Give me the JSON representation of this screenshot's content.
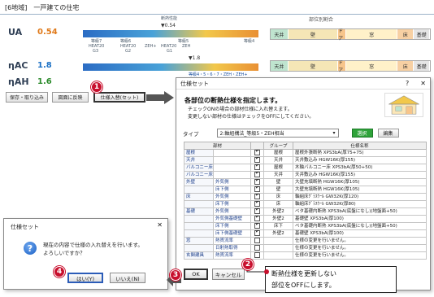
{
  "background": {
    "region_label": "[6地域]　一戸建ての住宅",
    "standard_caption": "断熱性能",
    "standard_value": "▼0.54",
    "parts_caption": "部位別割合",
    "metrics": [
      {
        "label": "UA",
        "value": "0.54",
        "color": "#e07a1a"
      },
      {
        "label": "ηAC",
        "value": "1.8",
        "color": "#1a6fc4"
      },
      {
        "label": "ηAH",
        "value": "1.6",
        "color": "#2a8a2a"
      }
    ],
    "ua_grades": [
      "等級7",
      "等級6",
      "等級5",
      "等級4"
    ],
    "ua_levels": [
      "HEAT20",
      "HEAT20",
      "ZEH+",
      "HEAT20",
      "ZEH"
    ],
    "ua_levels2": [
      "G3",
      "G2",
      "G1"
    ],
    "eta_mark": "▼1.8",
    "eta_grades": "等級4・5・6・7・ZEH・ZEH+",
    "parts_segments": [
      "天井",
      "壁",
      "ドア",
      "窓",
      "床",
      "基礎"
    ],
    "parts_colors": [
      "#bfe4cf",
      "#f5e6b6",
      "#f7c58b",
      "#fff1c9",
      "#f7d0a3",
      "#e5e5e5"
    ],
    "buttons": [
      "保存・取り込み",
      "図面に反映",
      "仕様入替(セット)"
    ]
  },
  "main_dialog": {
    "title": "仕様セット",
    "help": "?",
    "close": "✕",
    "heading": "各部位の断熱仕様を指定します。",
    "desc_line1": "チェックONの場合の部材仕様に入れ替えます。",
    "desc_line2": "変更しない部材の仕様はチェックをOFFにしてください。",
    "type_label": "タイプ",
    "type_value": "2:軸組構法_等級5・ZEH相当",
    "select_btn": "選択",
    "edit_btn": "編集",
    "headers": [
      "部材",
      "",
      "グループ",
      "仕様名称"
    ],
    "rows": [
      {
        "cat": "屋根",
        "sub": "",
        "on": true,
        "group": "屋根",
        "spec": "屋根外張断熱 XPS3bA(厚75+75)"
      },
      {
        "cat": "天井",
        "sub": "",
        "on": true,
        "group": "天井",
        "spec": "天井敷込み HGW16K(厚155)"
      },
      {
        "cat": "バルコニー床(屋根断熱)",
        "sub": "",
        "on": true,
        "group": "屋根",
        "spec": "木軸バルコニー床 XPS3bA(厚50+50)"
      },
      {
        "cat": "バルコニー床(天井断熱)",
        "sub": "",
        "on": true,
        "group": "天井",
        "spec": "天井敷込み HGW16K(厚155)"
      },
      {
        "cat": "外壁",
        "sub": "外気側",
        "on": true,
        "group": "壁",
        "spec": "大壁充填断熱 HGW16K(厚105)"
      },
      {
        "cat": "",
        "sub": "床下側",
        "on": true,
        "group": "壁",
        "spec": "大壁充填断熱 HGW16K(厚105)"
      },
      {
        "cat": "床",
        "sub": "外気側",
        "on": true,
        "group": "床",
        "spec": "軸組床ｸﾞﾗｽｳｰﾙ GW32K(厚120)"
      },
      {
        "cat": "",
        "sub": "床下側",
        "on": true,
        "group": "床",
        "spec": "軸組床ｸﾞﾗｽｳｰﾙ GW32K(厚80)"
      },
      {
        "cat": "基礎",
        "sub": "外気側",
        "on": true,
        "group": "外壁2",
        "spec": "ベタ基礎内断熱 XPS3bA(底盤になし)(地盤面+50)"
      },
      {
        "cat": "",
        "sub": "外気側基礎壁",
        "on": true,
        "group": "外壁2",
        "spec": "基礎壁 XPS3bA(厚100)"
      },
      {
        "cat": "",
        "sub": "床下側",
        "on": true,
        "group": "床下",
        "spec": "ベタ基礎内断熱 XPS3bA(底盤になし)(地盤面+50)"
      },
      {
        "cat": "",
        "sub": "床下側基礎壁",
        "on": true,
        "group": "外壁2",
        "spec": "基礎壁 XPS3bA(厚100)"
      },
      {
        "cat": "窓",
        "sub": "熱貫流率",
        "on": false,
        "group": "",
        "spec": "仕様の変更を行いません。"
      },
      {
        "cat": "",
        "sub": "日射熱取得",
        "on": false,
        "group": "",
        "spec": "仕様の変更を行いません。"
      },
      {
        "cat": "玄関建具",
        "sub": "熱貫流率",
        "on": false,
        "group": "",
        "spec": "仕様の変更を行いません。"
      }
    ],
    "ok": "OK",
    "cancel": "キャンセル"
  },
  "callout": {
    "line1": "断熱仕様を更新しない",
    "line2": "部位をOFFにします。"
  },
  "confirm_dialog": {
    "title": "仕様セット",
    "close": "✕",
    "msg_line1": "現在の内容で仕様の入れ替えを行います。",
    "msg_line2": "よろしいですか？",
    "yes": "はい(Y)",
    "no": "いいえ(N)"
  },
  "steps": [
    "1",
    "2",
    "3",
    "4"
  ]
}
